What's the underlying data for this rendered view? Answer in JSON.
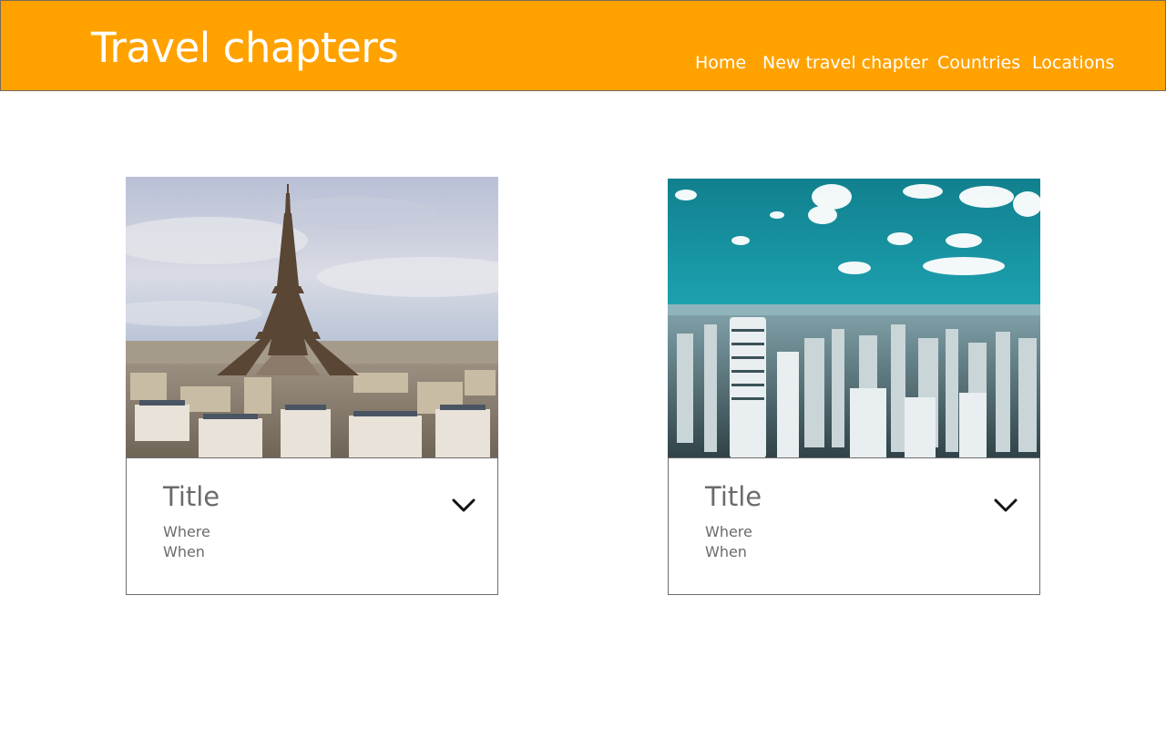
{
  "header": {
    "brand": "Travel chapters",
    "background": "#ffa200",
    "nav": [
      {
        "label": "Home"
      },
      {
        "label": "New travel chapter"
      },
      {
        "label": "Countries"
      },
      {
        "label": "Locations"
      }
    ]
  },
  "cards": [
    {
      "image": "eiffel-tower-paris-photo",
      "title": "Title",
      "where": "Where",
      "when": "When",
      "toggle_icon": "chevron-down-icon"
    },
    {
      "image": "city-skyline-photo",
      "title": "Title",
      "where": "Where",
      "when": "When",
      "toggle_icon": "chevron-down-icon"
    }
  ]
}
